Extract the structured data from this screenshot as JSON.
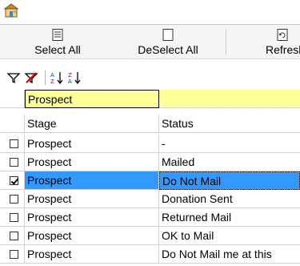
{
  "toolbar": {
    "select_all": "Select All",
    "deselect_all": "DeSelect All",
    "refresh": "Refresh"
  },
  "filter_row": {
    "stage_value": "Prospect",
    "status_value": ""
  },
  "columns": {
    "stage": "Stage",
    "status": "Status"
  },
  "rows": [
    {
      "checked": false,
      "stage": "Prospect",
      "status": "-"
    },
    {
      "checked": false,
      "stage": "Prospect",
      "status": "Mailed"
    },
    {
      "checked": true,
      "stage": "Prospect",
      "status": "Do Not Mail",
      "selected": true
    },
    {
      "checked": false,
      "stage": "Prospect",
      "status": "Donation Sent"
    },
    {
      "checked": false,
      "stage": "Prospect",
      "status": "Returned Mail"
    },
    {
      "checked": false,
      "stage": "Prospect",
      "status": "OK to Mail"
    },
    {
      "checked": false,
      "stage": "Prospect",
      "status": "Do Not Mail me at this"
    }
  ],
  "colors": {
    "filter_row_bg": "#ffff99",
    "selection_bg": "#3399ff"
  }
}
